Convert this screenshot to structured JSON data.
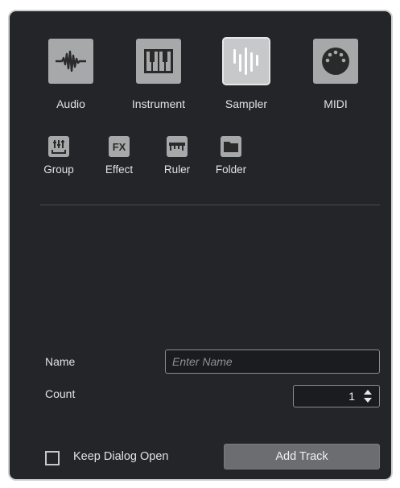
{
  "track_types": [
    {
      "id": "audio",
      "label": "Audio",
      "icon": "audio-waveform-icon",
      "selected": false
    },
    {
      "id": "instrument",
      "label": "Instrument",
      "icon": "piano-keys-icon",
      "selected": false
    },
    {
      "id": "sampler",
      "label": "Sampler",
      "icon": "sampler-bars-icon",
      "selected": true
    },
    {
      "id": "midi",
      "label": "MIDI",
      "icon": "midi-connector-icon",
      "selected": false
    }
  ],
  "small_types": [
    {
      "id": "group",
      "label": "Group",
      "icon": "group-faders-icon"
    },
    {
      "id": "effect",
      "label": "Effect",
      "icon": "fx-icon",
      "glyph": "FX"
    },
    {
      "id": "ruler",
      "label": "Ruler",
      "icon": "ruler-icon"
    },
    {
      "id": "folder",
      "label": "Folder",
      "icon": "folder-icon"
    }
  ],
  "form": {
    "name_label": "Name",
    "name_placeholder": "Enter Name",
    "name_value": "",
    "count_label": "Count",
    "count_value": "1"
  },
  "footer": {
    "keep_open_label": "Keep Dialog Open",
    "keep_open_checked": false,
    "add_button_label": "Add Track"
  },
  "colors": {
    "dialog_bg": "#232528",
    "tile": "#a7a8a9",
    "tile_selected": "#c7c8c9",
    "button": "#6b6d70"
  }
}
